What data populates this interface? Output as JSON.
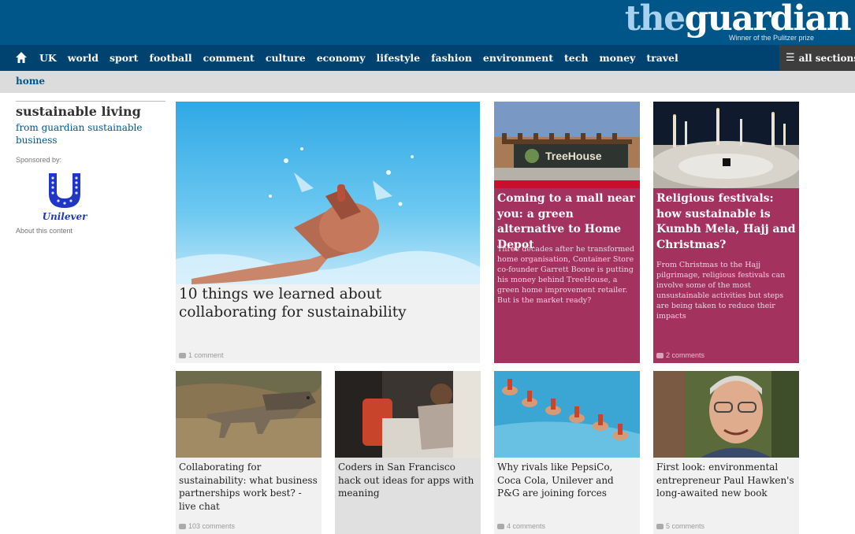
{
  "header": {
    "logo_the": "the",
    "logo_guardian": "guardian",
    "tagline": "Winner of the Pulitzer prize"
  },
  "nav": {
    "home_icon": "home-icon",
    "items": [
      "UK",
      "world",
      "sport",
      "football",
      "comment",
      "culture",
      "economy",
      "lifestyle",
      "fashion",
      "environment",
      "tech",
      "money",
      "travel"
    ],
    "all_sections": "all sections"
  },
  "breadcrumb": "home",
  "sidebar": {
    "title": "sustainable living",
    "subtitle": "from guardian sustainable business",
    "sponsored_by": "Sponsored by:",
    "sponsor_logo_text": "Unilever",
    "about": "About this content"
  },
  "cards": {
    "feature": {
      "headline": "10 things we learned about collaborating for sustainability",
      "comments": "1 comment"
    },
    "mall": {
      "image_sign": "TreeHouse",
      "headline": "Coming to a mall near you: a green alternative to Home Depot",
      "standfirst": "Three decades after he transformed home organisation, Container Store co-founder Garrett Boone is putting his money behind TreeHouse, a green home improvement retailer. But is the market ready?"
    },
    "festivals": {
      "headline": "Religious festivals: how sustainable is Kumbh Mela, Hajj and Christmas?",
      "standfirst": "From Christmas to the Hajj pilgrimage, religious festivals can involve some of the most unsustainable activities but steps are being taken to reduce their impacts",
      "comments": "2 comments"
    },
    "wolves": {
      "headline": "Collaborating for sustainability: what business partnerships work best? - live chat",
      "comments": "103 comments"
    },
    "coders": {
      "headline": "Coders in San Francisco hack out ideas for apps with meaning"
    },
    "rivals": {
      "headline": "Why rivals like PepsiCo, Coca Cola, Unilever and P&G are joining forces",
      "comments": "4 comments"
    },
    "hawken": {
      "headline": "First look: environmental entrepreneur Paul Hawken's long-awaited new book",
      "comments": "5 comments"
    }
  },
  "colors": {
    "brand_blue": "#005689",
    "nav_blue": "#004370",
    "magenta": "#a3325f",
    "grey_bg": "#f1f1f1"
  }
}
